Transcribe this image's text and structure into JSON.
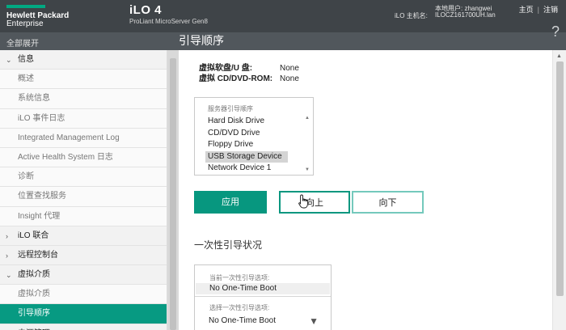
{
  "header": {
    "brand_line1": "Hewlett Packard",
    "brand_line2": "Enterprise",
    "product_name": "iLO 4",
    "product_model": "ProLiant MicroServer Gen8",
    "user_label": "本地用户: zhangwei",
    "host_label": "iLO 主机名:",
    "host_value": "ILOCZ161700UH.lan",
    "home_link": "主页",
    "separator": "|",
    "logout_link": "注销"
  },
  "subheader": {
    "expand_all": "全部展开",
    "page_title": "引导顺序",
    "help_icon": "?"
  },
  "sidebar": {
    "items": [
      {
        "label": "信息",
        "kind": "section",
        "chev": "⌄"
      },
      {
        "label": "概述",
        "kind": "child"
      },
      {
        "label": "系统信息",
        "kind": "child"
      },
      {
        "label": "iLO 事件日志",
        "kind": "child"
      },
      {
        "label": "Integrated Management Log",
        "kind": "child"
      },
      {
        "label": "Active Health System 日志",
        "kind": "child"
      },
      {
        "label": "诊断",
        "kind": "child"
      },
      {
        "label": "位置查找服务",
        "kind": "child"
      },
      {
        "label": "Insight 代理",
        "kind": "child"
      },
      {
        "label": "iLO 联合",
        "kind": "section",
        "chev": "›"
      },
      {
        "label": "远程控制台",
        "kind": "section",
        "chev": "›"
      },
      {
        "label": "虚拟介质",
        "kind": "section",
        "chev": "⌄"
      },
      {
        "label": "虚拟介质",
        "kind": "child"
      },
      {
        "label": "引导顺序",
        "kind": "child",
        "active": true
      },
      {
        "label": "电源管理",
        "kind": "section",
        "chev": "›"
      }
    ]
  },
  "media": {
    "floppy_label": "虚拟软盘/U 盘:",
    "floppy_value": "None",
    "cd_label": "虚拟 CD/DVD-ROM:",
    "cd_value": "None"
  },
  "boot_order": {
    "heading": "服务器引导顺序",
    "items": [
      "Hard Disk Drive",
      "CD/DVD Drive",
      "Floppy Drive",
      "USB Storage Device",
      "Network Device 1"
    ],
    "selected_index": 3
  },
  "buttons": {
    "apply": "应用",
    "up": "向上",
    "down": "向下"
  },
  "one_time": {
    "section_title": "一次性引导状况",
    "current_label": "当前一次性引导选项:",
    "current_value": "No One-Time Boot",
    "select_label": "选择一次性引导选项:",
    "select_value": "No One-Time Boot"
  },
  "icons": {
    "cursor": "hand-pointer-icon",
    "caret": "▼",
    "scroll_up": "▲",
    "scroll_down": "▼"
  },
  "colors": {
    "accent": "#07977f",
    "header_bg": "#3f4448",
    "subheader_bg": "#51575c"
  }
}
